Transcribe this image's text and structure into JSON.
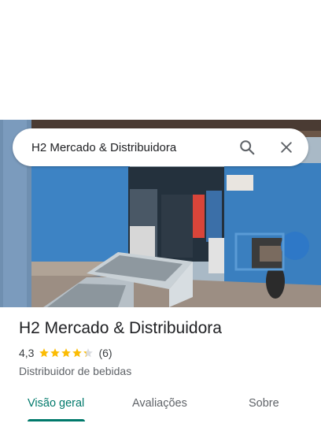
{
  "search": {
    "query": "H2 Mercado & Distribuidora"
  },
  "place": {
    "name": "H2 Mercado & Distribuidora",
    "rating": "4,3",
    "stars": 4.3,
    "review_count": "(6)",
    "category": "Distribuidor de bebidas"
  },
  "tabs": [
    {
      "label": "Visão geral",
      "active": true
    },
    {
      "label": "Avaliações",
      "active": false
    },
    {
      "label": "Sobre",
      "active": false
    }
  ],
  "colors": {
    "accent": "#00796b",
    "star": "#fbbc04"
  },
  "icons": {
    "search": "search-icon",
    "close": "close-icon"
  }
}
